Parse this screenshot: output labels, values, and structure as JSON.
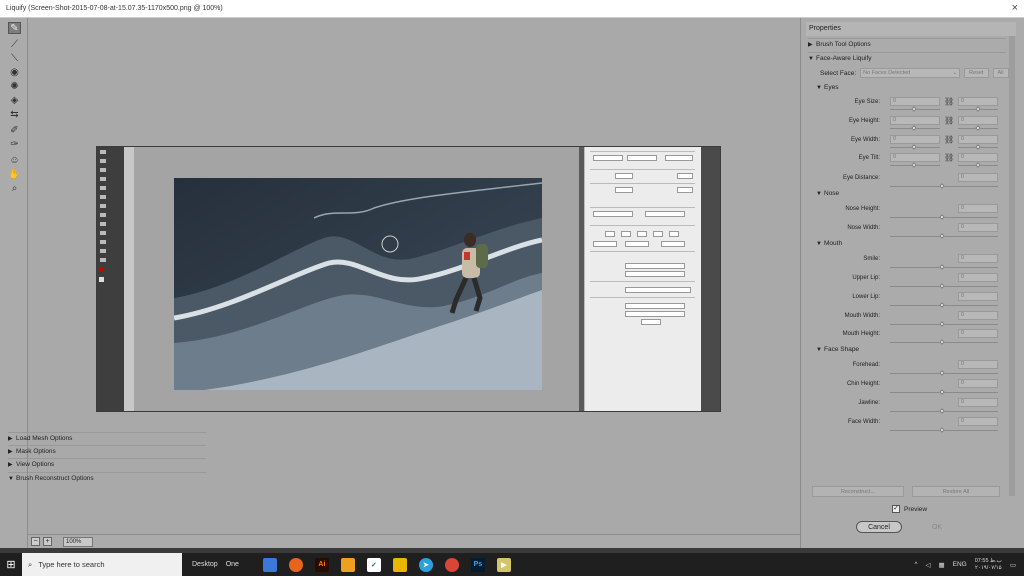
{
  "window": {
    "title": "Liquify (Screen-Shot-2015-07-08-at-15.07.35-1170x500.png @ 100%)",
    "close": "×"
  },
  "toolbar": {
    "tools": [
      "forward-warp",
      "reconstruct",
      "smooth",
      "twirl",
      "pucker",
      "bloat",
      "push-left",
      "freeze-mask",
      "thaw-mask",
      "face-tool",
      "hand",
      "zoom"
    ]
  },
  "canvas": {
    "zoom": "100%",
    "minus": "−",
    "plus": "+"
  },
  "properties": {
    "header": "Properties",
    "brush_tool_options": "Brush Tool Options",
    "face_aware": "Face-Aware Liquify",
    "select_face_label": "Select Face:",
    "select_face_value": "No Faces Detected",
    "reset": "Reset",
    "all": "All",
    "eyes": "Eyes",
    "eye_size": "Eye Size:",
    "eye_height": "Eye Height:",
    "eye_width": "Eye Width:",
    "eye_tilt": "Eye Tilt:",
    "eye_distance": "Eye Distance:",
    "nose": "Nose",
    "nose_height": "Nose Height:",
    "nose_width": "Nose Width:",
    "mouth": "Mouth",
    "smile": "Smile:",
    "upper_lip": "Upper Lip:",
    "lower_lip": "Lower Lip:",
    "mouth_width": "Mouth Width:",
    "mouth_height": "Mouth Height:",
    "face_shape": "Face Shape",
    "forehead": "Forehead:",
    "chin_height": "Chin Height:",
    "jawline": "Jawline:",
    "face_width": "Face Width:",
    "zero": "0",
    "load_mesh": "Load Mesh Options",
    "mask_options": "Mask Options",
    "view_options": "View Options",
    "brush_reconstruct": "Brush Reconstruct Options",
    "reconstruct": "Reconstruct...",
    "restore_all": "Restore All",
    "preview": "Preview",
    "cancel": "Cancel",
    "ok": "OK"
  },
  "taskbar": {
    "search_placeholder": "Type here to search",
    "desktop": "Desktop",
    "one": "One",
    "lang": "ENG",
    "time": "07:55 ب.ظ",
    "date": "۲۰۱۹/۰۷/۱۵"
  }
}
